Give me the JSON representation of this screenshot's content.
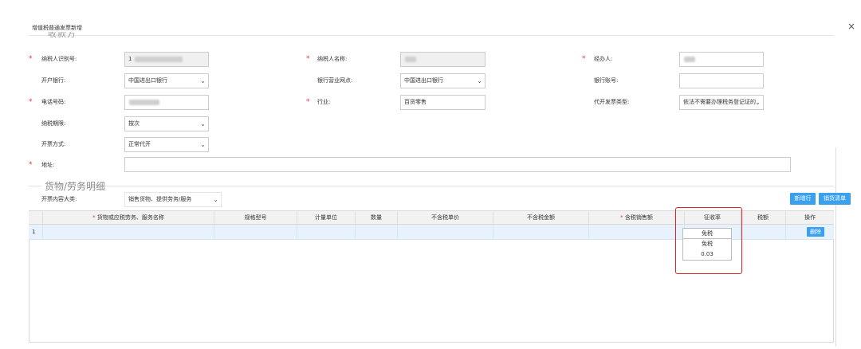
{
  "dialog": {
    "title": "增值税普通发票新增",
    "close_symbol": "×",
    "cut_legend": "收款方"
  },
  "form": {
    "taxpayer_id_label": "纳税人识别号:",
    "taxpayer_id_prefix": "1",
    "taxpayer_name_label": "纳税人名称:",
    "handler_label": "经办人:",
    "bank_label": "开户银行:",
    "bank_value": "中国进出口银行",
    "branch_label": "银行营业网点:",
    "branch_value": "中国进出口银行",
    "account_label": "银行账号:",
    "account_value": "",
    "phone_label": "电话号码:",
    "industry_label": "行业:",
    "industry_value": "百货零售",
    "invoice_type_label": "代开发票类型:",
    "invoice_type_value": "依法不需要办理税务登记证的",
    "tax_period_label": "纳税期限:",
    "tax_period_value": "按次",
    "issue_method_label": "开票方式:",
    "issue_method_value": "正常代开",
    "address_label": "地址:",
    "address_value": ""
  },
  "goods": {
    "legend": "货物/劳务明细",
    "category_label": "开票内容大类:",
    "category_value": "销售货物、提供劳务/服务",
    "add_row_label": "新增行",
    "import_list_label": "销货清单",
    "columns": [
      "货物或应税劳务、服务名称",
      "规格型号",
      "计量单位",
      "数量",
      "不含税单价",
      "不含税金额",
      "含税销售额",
      "征收率",
      "税额",
      "操作"
    ],
    "rows": [
      {
        "index": "1",
        "delete_label": "删除"
      }
    ]
  },
  "rate_dropdown": {
    "selected": "免税",
    "options": [
      "免税",
      "0.03"
    ]
  },
  "colors": {
    "accent": "#3aa0f0",
    "required": "#e4393c",
    "highlight": "#e02020",
    "row_selected": "#e8f2fc"
  }
}
